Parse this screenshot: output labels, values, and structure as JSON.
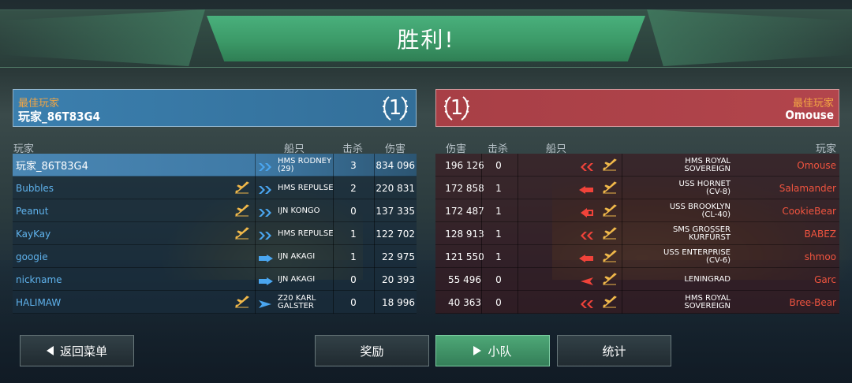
{
  "title": "胜利!",
  "colors": {
    "left_team": "#3b7fae",
    "right_team": "#a83f46",
    "mvp_label": "#f3a644",
    "left_name": "#5fb2ec",
    "right_name": "#f0543f",
    "active_button": "#4ea877"
  },
  "left_team": {
    "mvp_label": "最佳玩家",
    "mvp_name": "玩家_86T83G4",
    "score": "1",
    "headers": {
      "player": "玩家",
      "ship": "船只",
      "kills": "击杀",
      "damage": "伤害"
    },
    "rows": [
      {
        "player": "玩家_86T83G4",
        "ship1": "HMS RODNEY",
        "ship2": "(29)",
        "kills": "3",
        "damage": "834 096",
        "icon": "battleship-icon",
        "plane": false
      },
      {
        "player": "Bubbles",
        "ship1": "HMS REPULSE",
        "ship2": "",
        "kills": "2",
        "damage": "220 831",
        "icon": "battleship-icon",
        "plane": true
      },
      {
        "player": "Peanut",
        "ship1": "IJN KONGO",
        "ship2": "",
        "kills": "0",
        "damage": "137 335",
        "icon": "battleship-icon",
        "plane": true
      },
      {
        "player": "KayKay",
        "ship1": "HMS REPULSE",
        "ship2": "",
        "kills": "1",
        "damage": "122 702",
        "icon": "battleship-icon",
        "plane": true
      },
      {
        "player": "googie",
        "ship1": "IJN AKAGI",
        "ship2": "",
        "kills": "1",
        "damage": "22 975",
        "icon": "carrier-icon",
        "plane": false
      },
      {
        "player": "nickname",
        "ship1": "IJN AKAGI",
        "ship2": "",
        "kills": "0",
        "damage": "20 393",
        "icon": "carrier-icon",
        "plane": false
      },
      {
        "player": "HALIMAW",
        "ship1": "Z20 KARL",
        "ship2": "GALSTER",
        "kills": "0",
        "damage": "18 996",
        "icon": "destroyer-icon",
        "plane": true
      }
    ]
  },
  "right_team": {
    "mvp_label": "最佳玩家",
    "mvp_name": "Omouse",
    "score": "1",
    "headers": {
      "damage": "伤害",
      "kills": "击杀",
      "ship": "船只",
      "player": "玩家"
    },
    "rows": [
      {
        "player": "Omouse",
        "ship1": "HMS ROYAL",
        "ship2": "SOVEREIGN",
        "kills": "0",
        "damage": "196 126",
        "icon": "battleship-icon"
      },
      {
        "player": "Salamander",
        "ship1": "USS HORNET",
        "ship2": "(CV-8)",
        "kills": "1",
        "damage": "172 858",
        "icon": "carrier-icon"
      },
      {
        "player": "CookieBear",
        "ship1": "USS BROOKLYN",
        "ship2": "(CL-40)",
        "kills": "1",
        "damage": "172 487",
        "icon": "cruiser-icon"
      },
      {
        "player": "BABEZ",
        "ship1": "SMS GROSSER",
        "ship2": "KURFÜRST",
        "kills": "1",
        "damage": "128 913",
        "icon": "battleship-icon"
      },
      {
        "player": "shmoo",
        "ship1": "USS ENTERPRISE",
        "ship2": "(CV-6)",
        "kills": "1",
        "damage": "121 550",
        "icon": "carrier-icon"
      },
      {
        "player": "Garc",
        "ship1": "LENINGRAD",
        "ship2": "",
        "kills": "0",
        "damage": "55 496",
        "icon": "destroyer-icon"
      },
      {
        "player": "Bree-Bear",
        "ship1": "HMS ROYAL",
        "ship2": "SOVEREIGN",
        "kills": "0",
        "damage": "40 363",
        "icon": "battleship-icon"
      }
    ]
  },
  "buttons": {
    "back": "返回菜单",
    "rewards": "奖励",
    "squad": "小队",
    "stats": "统计"
  }
}
